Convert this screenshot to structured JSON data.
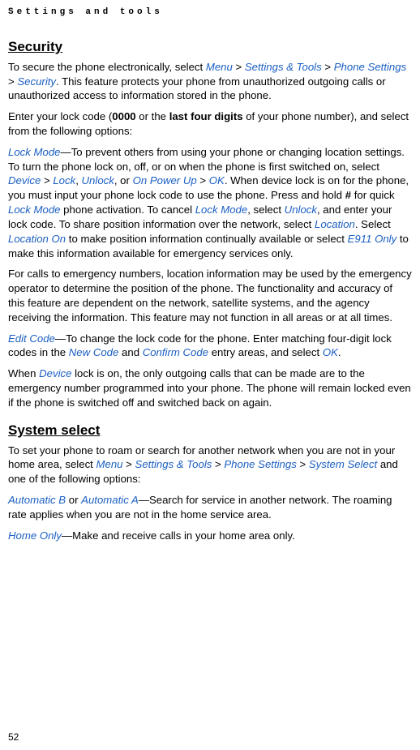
{
  "running_header": "Settings and tools",
  "security": {
    "title": "Security",
    "p1_a": "To secure the phone electronically, select ",
    "menu": "Menu",
    "gt": " > ",
    "settingsTools": "Settings & Tools",
    "phoneSettings": "Phone Settings",
    "security_link": "Security",
    "p1_b": ". This feature protects your phone from unauthorized outgoing calls or unauthorized access to information stored in the phone.",
    "p2_a": "Enter your lock code (",
    "p2_0000": "0000",
    "p2_b": " or the ",
    "p2_last4": "last four digits",
    "p2_c": " of your phone number), and select from the following options:",
    "lockmode": "Lock Mode",
    "p3_a": "—To prevent others from using your phone or changing location settings. To turn the phone lock on, off, or on when the phone is first switched on, select ",
    "device": "Device",
    "lock": "Lock",
    "unlock": "Unlock",
    "onpowerup": "On Power Up",
    "ok": "OK",
    "p3_b": ". When device lock is on for the phone, you must input your phone lock code to use the phone. Press and hold ",
    "hash": "#",
    "p3_c": " for quick ",
    "p3_d": " phone activation. To cancel ",
    "p3_e": ", select ",
    "p3_f": ", and enter your lock code. To share position information over the network, select ",
    "location": "Location",
    "p3_g": ". Select ",
    "locationOn": "Location On",
    "p3_h": " to make position information continually available or select ",
    "e911": "E911 Only",
    "p3_i": " to make this information available for emergency services only.",
    "p4": "For calls to emergency numbers, location information may be used by the emergency operator to determine the position of the phone. The functionality and accuracy of this feature are dependent on the network, satellite systems, and the agency receiving the information. This feature may not function in all areas or at all times.",
    "editcode": "Edit Code",
    "p5_a": "—To change the lock code for the phone. Enter matching four-digit lock codes in the ",
    "newcode": "New Code",
    "p5_b": " and ",
    "confirmcode": "Confirm Code",
    "p5_c": " entry areas, and select ",
    "p6_a": "When ",
    "p6_b": " lock is on, the only outgoing calls that can be made are to the emergency number programmed into your phone. The phone will remain locked even if the phone is switched off and switched back on again."
  },
  "system": {
    "title": "System select",
    "p1_a": "To set your phone to roam or search for another network when you are not in your home area, select ",
    "systemselect": "System Select",
    "p1_b": " and one of the following options:",
    "autoB": "Automatic B",
    "or": " or ",
    "autoA": "Automatic A",
    "p2": "—Search for service in another network. The roaming rate applies when you are not in the home service area.",
    "homeonly": "Home Only",
    "p3": "—Make and receive calls in your home area only."
  },
  "page": "52",
  "comma": ", ",
  "period": "."
}
